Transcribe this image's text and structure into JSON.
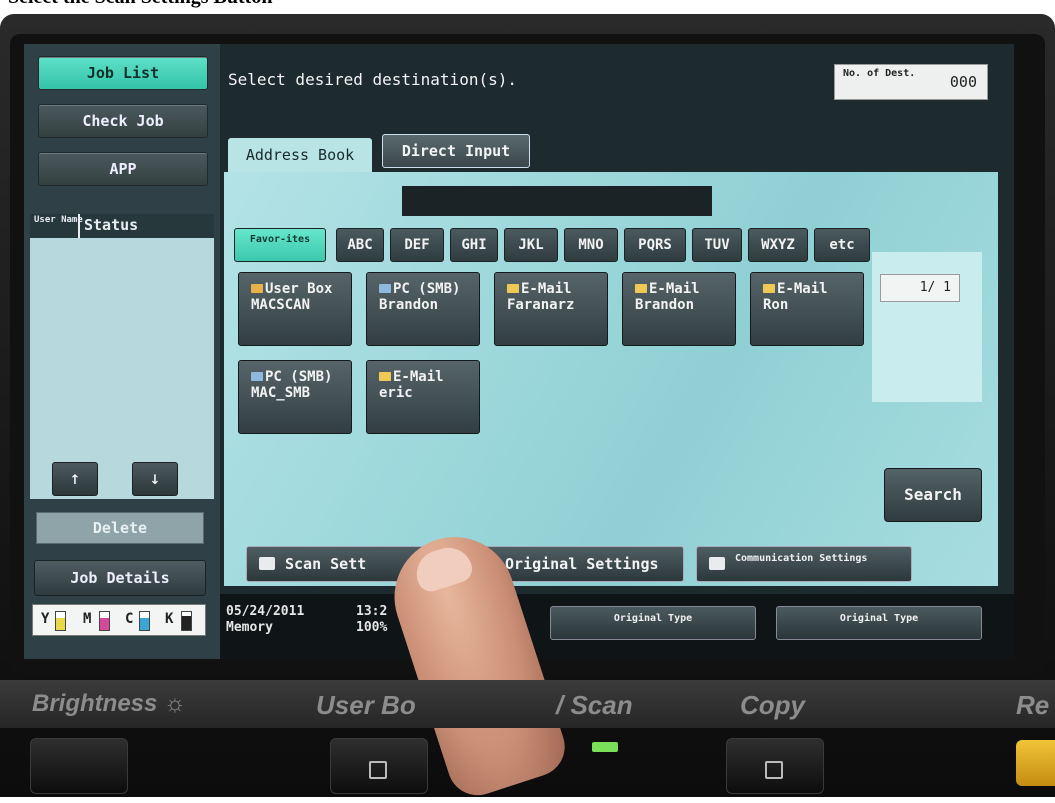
{
  "caption": "Select the Scan Settings Button",
  "left_panel": {
    "job_list": "Job List",
    "check_job": "Check Job",
    "app": "APP",
    "user_name_col": "User Name",
    "status_col": "Status",
    "up_arrow": "↑",
    "down_arrow": "↓",
    "delete": "Delete",
    "job_details": "Job Details",
    "toner": [
      {
        "label": "Y",
        "color": "#e8d84a"
      },
      {
        "label": "M",
        "color": "#d44a9a"
      },
      {
        "label": "C",
        "color": "#3aa6d8"
      },
      {
        "label": "K",
        "color": "#222222"
      }
    ]
  },
  "header": {
    "prompt": "Select desired destination(s).",
    "dest_label": "No. of Dest.",
    "dest_count": "000"
  },
  "tabs": {
    "address_book": "Address Book",
    "direct_input": "Direct Input"
  },
  "index": [
    "Favor-ites",
    "ABC",
    "DEF",
    "GHI",
    "JKL",
    "MNO",
    "PQRS",
    "TUV",
    "WXYZ",
    "etc"
  ],
  "destinations": [
    {
      "type": "User Box",
      "name": "MACSCAN",
      "icon": "user-box-icon"
    },
    {
      "type": "PC (SMB)",
      "name": "Brandon",
      "icon": "pc-smb-icon"
    },
    {
      "type": "E-Mail",
      "name": "Faranarz",
      "icon": "email-icon"
    },
    {
      "type": "E-Mail",
      "name": "Brandon",
      "icon": "email-icon"
    },
    {
      "type": "E-Mail",
      "name": "Ron",
      "icon": "email-icon"
    },
    {
      "type": "PC (SMB)",
      "name": "MAC_SMB",
      "icon": "pc-smb-icon"
    },
    {
      "type": "E-Mail",
      "name": "eric",
      "icon": "email-icon"
    }
  ],
  "pager": "1/ 1",
  "search": "Search",
  "bottom_buttons": {
    "scan_settings": "Scan Sett",
    "original_settings": "Original Settings",
    "communication_settings": "Communication Settings"
  },
  "status": {
    "date": "05/24/2011",
    "time": "13:2",
    "memory_label": "Memory",
    "memory_value": "100%",
    "original_type_1": "Original Type",
    "original_type_2": "Original Type"
  },
  "hardware": {
    "brightness": "Brightness ☼",
    "user_box": "User Bo",
    "scan": "/ Scan",
    "copy": "Copy",
    "re": "Re"
  }
}
